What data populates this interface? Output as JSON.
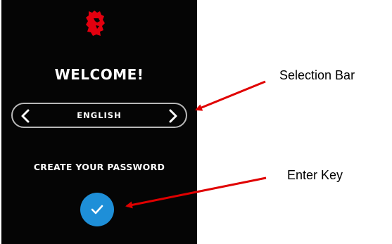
{
  "screen": {
    "welcome_title": "WELCOME!",
    "language": "ENGLISH",
    "create_password_label": "CREATE YOUR PASSWORD",
    "prev_icon": "chevron-left-icon",
    "next_icon": "chevron-right-icon",
    "enter_icon": "checkmark-icon"
  },
  "annotations": {
    "selection_bar": "Selection Bar",
    "enter_key": "Enter Key"
  },
  "colors": {
    "screen_background": "#050505",
    "enter_key": "#1e8fd8",
    "logo": "#e3000f",
    "arrow": "#e00000"
  }
}
